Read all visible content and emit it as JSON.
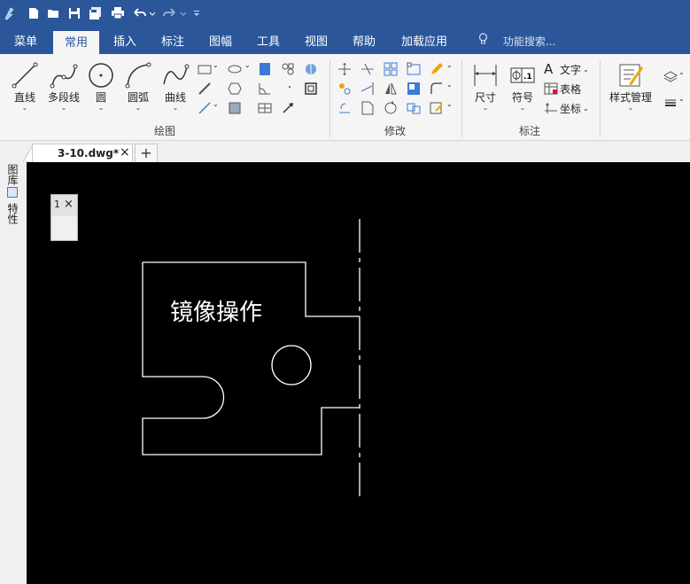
{
  "quick_access": {
    "icons": [
      "app-logo-icon",
      "new-file-icon",
      "open-file-icon",
      "save-icon",
      "save-all-icon",
      "print-icon",
      "undo-icon",
      "redo-icon",
      "customize-icon"
    ]
  },
  "menu": {
    "items": [
      "菜单",
      "常用",
      "插入",
      "标注",
      "图幅",
      "工具",
      "视图",
      "帮助",
      "加载应用"
    ],
    "active": "常用",
    "search_placeholder": "功能搜索..."
  },
  "ribbon": {
    "draw_group": {
      "label": "绘图",
      "tools": [
        "直线",
        "多段线",
        "圆",
        "圆弧",
        "曲线"
      ]
    },
    "modify_group": {
      "label": "修改"
    },
    "annotate_group": {
      "label": "标注",
      "tools": [
        "尺寸",
        "符号"
      ],
      "small_tools": [
        "文字",
        "表格",
        "坐标"
      ]
    },
    "style_group": {
      "tools": [
        "样式管理"
      ]
    }
  },
  "document": {
    "tab_label": "3-10.dwg*",
    "close": "×",
    "new_tab": "+"
  },
  "left_panel": {
    "tabs": [
      "图库",
      "特性"
    ]
  },
  "palette": {
    "close": "×",
    "partial_text": "1"
  },
  "drawing": {
    "annotation_text": "镜像操作",
    "background_color": "#000000",
    "line_color": "#ffffff"
  }
}
